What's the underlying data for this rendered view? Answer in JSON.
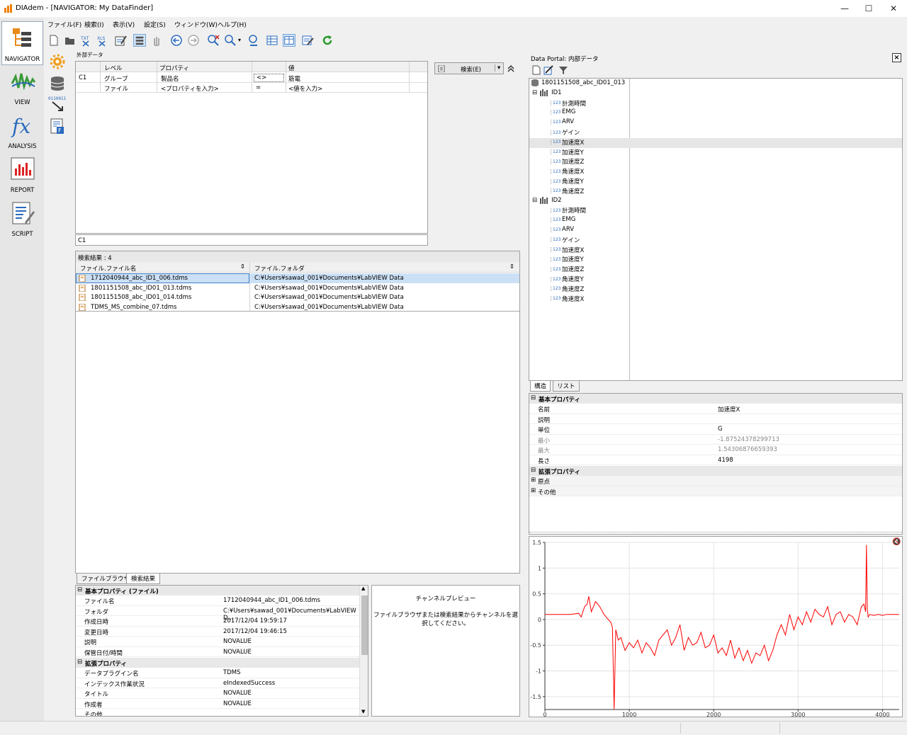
{
  "window": {
    "title": "DIAdem - [NAVIGATOR:  My DataFinder]"
  },
  "menu": [
    "ファイル(F)",
    "検索(I)",
    "表示(V)",
    "設定(S)",
    "ウィンドウ(W)",
    "ヘルプ(H)"
  ],
  "toolbar_icons": {
    "txt": "TXT",
    "xls": "XLS"
  },
  "nav": [
    "NAVIGATOR",
    "VIEW",
    "ANALYSIS",
    "REPORT",
    "SCRIPT"
  ],
  "secondary_nav": {
    "binary_text": "0110011"
  },
  "query": {
    "section_title": "外部データ",
    "headers": {
      "level": "レベル",
      "property": "プロパティ",
      "value": "値"
    },
    "rows": [
      {
        "id": "C1",
        "level": "グループ",
        "property": "製品名",
        "op": "<>",
        "value": "筋電"
      },
      {
        "id": "",
        "level": "ファイル",
        "property": "<プロパティを入力>",
        "op": "=",
        "value": "<値を入力>"
      }
    ],
    "search_button": "検索(E)",
    "expression": "C1"
  },
  "results": {
    "header": "検索結果 : 4",
    "columns": [
      "ファイル.ファイル名",
      "ファイル.フォルダ"
    ],
    "rows": [
      {
        "name": "1712040944_abc_ID1_006.tdms",
        "folder": "C:¥Users¥sawad_001¥Documents¥LabVIEW Data"
      },
      {
        "name": "1801151508_abc_ID01_013.tdms",
        "folder": "C:¥Users¥sawad_001¥Documents¥LabVIEW Data"
      },
      {
        "name": "1801151508_abc_ID01_014.tdms",
        "folder": "C:¥Users¥sawad_001¥Documents¥LabVIEW Data"
      },
      {
        "name": "TDMS_MS_combine_07.tdms",
        "folder": "C:¥Users¥sawad_001¥Documents¥LabVIEW Data"
      }
    ],
    "tabs": [
      "ファイルブラウザ",
      "検索結果"
    ]
  },
  "file_props": {
    "basic_header": "基本プロパティ (ファイル)",
    "basic": [
      {
        "k": "ファイル名",
        "v": "1712040944_abc_ID1_006.tdms"
      },
      {
        "k": "フォルダ",
        "v": "C:¥Users¥sawad_001¥Documents¥LabVIEW D..."
      },
      {
        "k": "作成日時",
        "v": "2017/12/04 19:59:17"
      },
      {
        "k": "変更日時",
        "v": "2017/12/04 19:46:15"
      },
      {
        "k": "説明",
        "v": "NOVALUE"
      },
      {
        "k": "保管日付/時間",
        "v": "NOVALUE"
      }
    ],
    "ext_header": "拡張プロパティ",
    "ext": [
      {
        "k": "データプラグイン名",
        "v": "TDMS"
      },
      {
        "k": "インデックス作業状況",
        "v": "eIndexedSuccess"
      },
      {
        "k": "タイトル",
        "v": "NOVALUE"
      },
      {
        "k": "作成者",
        "v": "NOVALUE"
      },
      {
        "k": "その他",
        "v": ""
      }
    ]
  },
  "preview": {
    "title": "チャンネルプレビュー",
    "message": "ファイルブラウザまたは検索結果からチャンネルを選択してください。"
  },
  "portal": {
    "title": "Data Portal: 内部データ",
    "root": "1801151508_abc_ID01_013",
    "groups": [
      {
        "name": "ID1",
        "channels": [
          "計測時間",
          "EMG",
          "ARV",
          "ゲイン",
          "加速度X",
          "加速度Y",
          "加速度Z",
          "角速度X",
          "角速度Y",
          "角速度Z"
        ]
      },
      {
        "name": "ID2",
        "channels": [
          "計測時間",
          "EMG",
          "ARV",
          "ゲイン",
          "加速度X",
          "加速度Y",
          "加速度Z",
          "角速度Y",
          "角速度Z",
          "角速度X"
        ]
      }
    ],
    "channel_icon_text": "123",
    "selected": "加速度X",
    "tabs": [
      "構造",
      "リスト"
    ]
  },
  "channel_props": {
    "basic_header": "基本プロパティ",
    "basic": [
      {
        "k": "名前",
        "v": "加速度X"
      },
      {
        "k": "説明",
        "v": ""
      },
      {
        "k": "単位",
        "v": "G"
      },
      {
        "k": "最小",
        "v": "-1.87524378299713"
      },
      {
        "k": "最大",
        "v": "1.54306876659393"
      },
      {
        "k": "長さ",
        "v": "4198"
      }
    ],
    "ext_header": "拡張プロパティ",
    "ext": [
      "原点",
      "その他"
    ]
  },
  "chart_data": {
    "type": "line",
    "xlim": [
      0,
      4198
    ],
    "ylim": [
      -1.75,
      1.5
    ],
    "xticks": [
      0,
      1000,
      2000,
      3000,
      4000
    ],
    "yticks": [
      1.5,
      1,
      0.5,
      0,
      -0.5,
      -1,
      -1.5
    ],
    "color": "#ff0000",
    "x": [
      0,
      100,
      200,
      300,
      400,
      430,
      470,
      500,
      520,
      550,
      600,
      650,
      700,
      750,
      780,
      800,
      820,
      840,
      870,
      900,
      950,
      1000,
      1050,
      1100,
      1150,
      1200,
      1250,
      1300,
      1350,
      1400,
      1450,
      1500,
      1550,
      1600,
      1650,
      1700,
      1750,
      1800,
      1850,
      1900,
      1950,
      2000,
      2050,
      2100,
      2150,
      2200,
      2250,
      2300,
      2350,
      2400,
      2450,
      2500,
      2550,
      2600,
      2650,
      2700,
      2750,
      2800,
      2850,
      2900,
      2950,
      3000,
      3050,
      3100,
      3150,
      3200,
      3250,
      3300,
      3350,
      3400,
      3450,
      3500,
      3550,
      3600,
      3650,
      3700,
      3750,
      3780,
      3800,
      3810,
      3820,
      3830,
      3850,
      3900,
      3950,
      4000,
      4050,
      4100,
      4150,
      4198
    ],
    "y": [
      0.1,
      0.1,
      0.1,
      0.1,
      0.12,
      0.05,
      0.25,
      0.3,
      0.45,
      0.15,
      0.35,
      0.25,
      0.1,
      0.0,
      -0.05,
      -0.15,
      -1.75,
      -0.2,
      -0.4,
      -0.35,
      -0.6,
      -0.45,
      -0.55,
      -0.4,
      -0.65,
      -0.45,
      -0.55,
      -0.7,
      -0.4,
      -0.3,
      -0.2,
      -0.5,
      -0.35,
      -0.1,
      -0.6,
      -0.35,
      -0.5,
      -0.45,
      -0.25,
      -0.55,
      -0.5,
      -0.3,
      -0.65,
      -0.55,
      -0.7,
      -0.4,
      -0.75,
      -0.55,
      -0.8,
      -0.6,
      -0.85,
      -0.65,
      -0.7,
      -0.5,
      -0.8,
      -0.6,
      -0.3,
      -0.1,
      -0.3,
      0.1,
      -0.2,
      0.05,
      -0.1,
      0.15,
      -0.05,
      0.2,
      0.1,
      0.05,
      0.25,
      -0.1,
      0.1,
      0.15,
      -0.05,
      0.1,
      0.05,
      -0.1,
      0.25,
      0.3,
      0.15,
      1.45,
      0.2,
      0.05,
      0.1,
      0.08,
      0.1,
      0.08,
      0.1,
      0.1,
      0.1,
      0.1
    ]
  }
}
